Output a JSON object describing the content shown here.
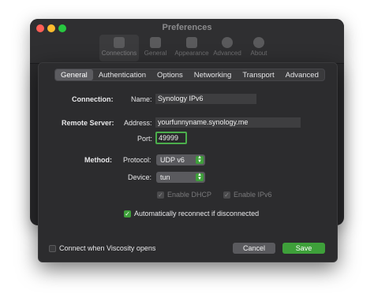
{
  "prefs_window": {
    "title": "Preferences",
    "toolbar": [
      {
        "label": "Connections",
        "icon": "connections-icon"
      },
      {
        "label": "General",
        "icon": "general-icon"
      },
      {
        "label": "Appearance",
        "icon": "appearance-icon"
      },
      {
        "label": "Advanced",
        "icon": "advanced-icon"
      },
      {
        "label": "About",
        "icon": "about-icon"
      }
    ]
  },
  "sheet": {
    "tabs": [
      "General",
      "Authentication",
      "Options",
      "Networking",
      "Transport",
      "Advanced"
    ],
    "selected_tab": "General",
    "connection": {
      "section_label": "Connection:",
      "name_label": "Name:",
      "name_value": "Synology IPv6"
    },
    "remote_server": {
      "section_label": "Remote Server:",
      "address_label": "Address:",
      "address_value": "yourfunnyname.synology.me",
      "port_label": "Port:",
      "port_value": "49999"
    },
    "method": {
      "section_label": "Method:",
      "protocol_label": "Protocol:",
      "protocol_value": "UDP v6",
      "device_label": "Device:",
      "device_value": "tun",
      "enable_dhcp_label": "Enable DHCP",
      "enable_ipv6_label": "Enable IPv6"
    },
    "auto_reconnect_label": "Automatically reconnect if disconnected",
    "connect_on_open_label": "Connect when Viscosity opens",
    "cancel_label": "Cancel",
    "save_label": "Save"
  },
  "colors": {
    "accent_green": "#3ea03a",
    "sheet_bg": "#2c2c2e",
    "window_bg": "#2a2a2c"
  }
}
